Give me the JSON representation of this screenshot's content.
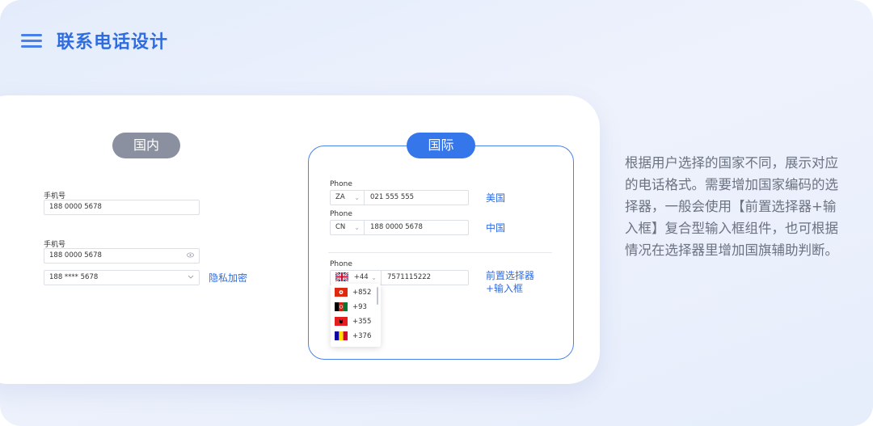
{
  "header": {
    "title": "联系电话设计"
  },
  "domestic": {
    "tag": "国内",
    "field1": {
      "label": "手机号",
      "value": "188 0000 5678"
    },
    "field2": {
      "label": "手机号",
      "value": "188 0000 5678",
      "suffix_icon": "eye-icon"
    },
    "field3": {
      "value": "188 **** 5678",
      "suffix_icon": "chevron-icon"
    },
    "privacy_note": "隐私加密"
  },
  "international": {
    "tag": "国际",
    "us": {
      "label": "Phone",
      "country": "ZA",
      "number": "021 555 555",
      "note": "美国"
    },
    "cn": {
      "label": "Phone",
      "country": "CN",
      "number": "188 0000 5678",
      "note": "中国"
    },
    "prefix": {
      "label": "Phone",
      "flag": "uk-flag",
      "code": "+44",
      "number": "7571115222",
      "note_line1": "前置选择器",
      "note_line2": "+输入框",
      "options": [
        {
          "flag": "hong-kong-flag",
          "code": "+852"
        },
        {
          "flag": "afghanistan-flag",
          "code": "+93"
        },
        {
          "flag": "albania-flag",
          "code": "+355"
        },
        {
          "flag": "andorra-flag",
          "code": "+376"
        }
      ]
    }
  },
  "description": "根据用户选择的国家不同，展示对应的电话格式。需要增加国家编码的选择器，一般会使用【前置选择器+输入框】复合型输入框组件，也可根据情况在选择器里增加国旗辅助判断。",
  "colors": {
    "accent": "#3577ea",
    "title": "#2f6ce0",
    "domestic_tag": "#8a90a0",
    "description": "#6b7280"
  }
}
